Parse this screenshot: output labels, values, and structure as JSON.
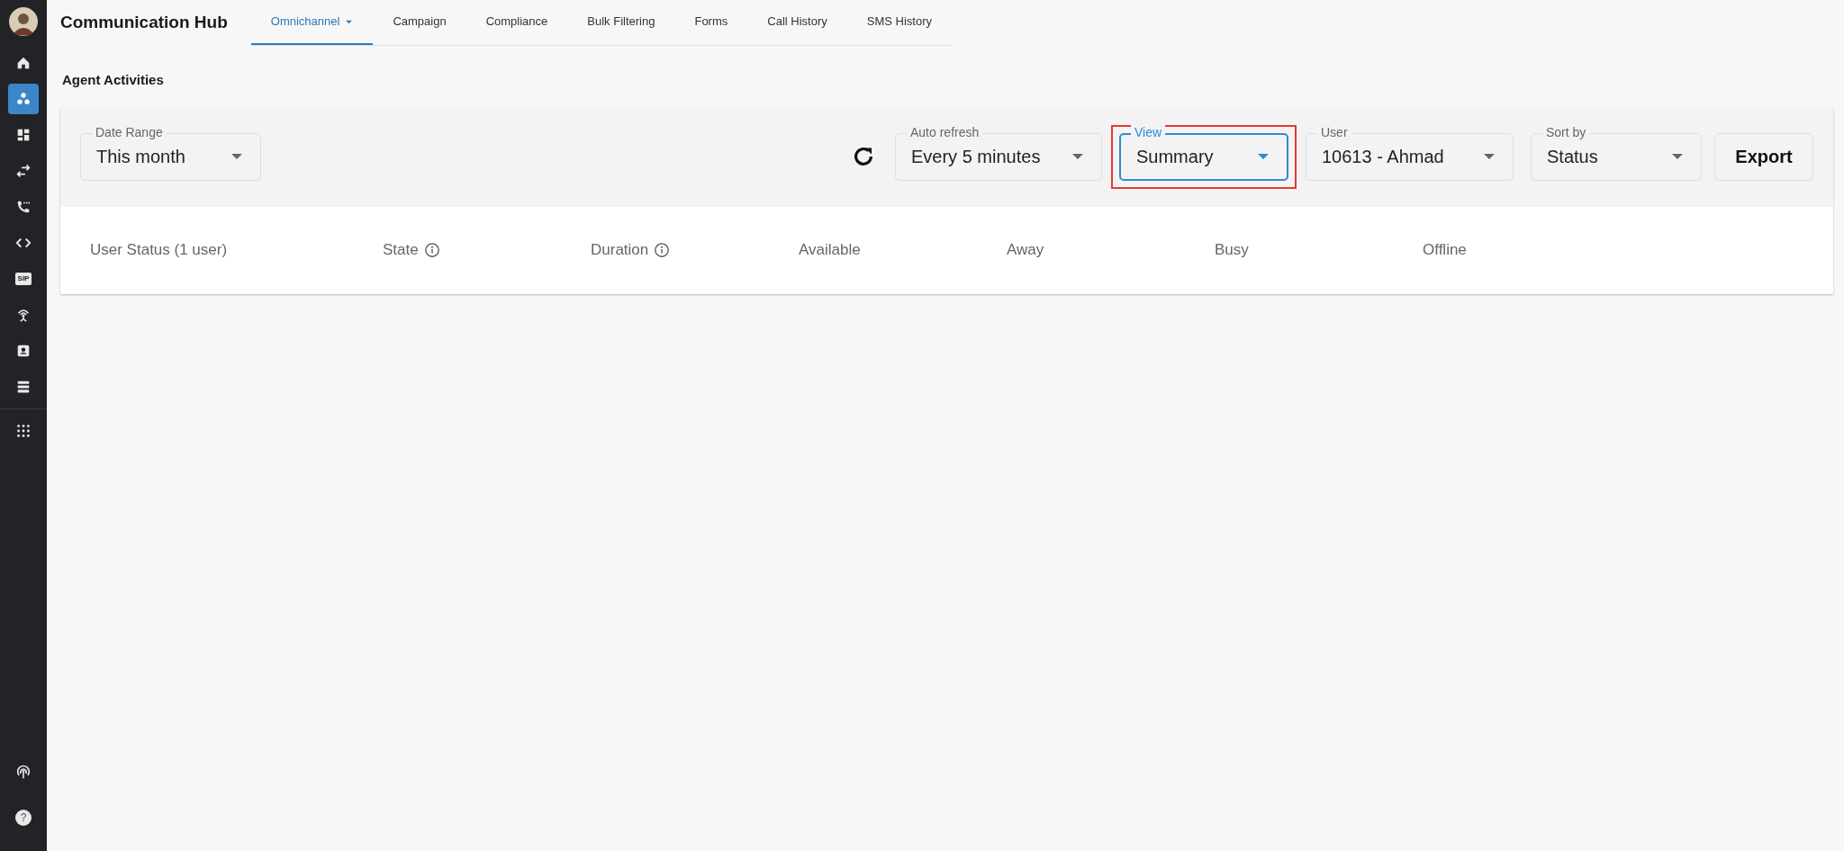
{
  "app": {
    "title": "Communication Hub"
  },
  "sidebar": {
    "items": [
      {
        "selected": false
      },
      {
        "selected": true
      },
      {
        "selected": false
      },
      {
        "selected": false
      },
      {
        "selected": false
      },
      {
        "selected": false
      },
      {
        "selected": false,
        "label": "SIP"
      },
      {
        "selected": false
      },
      {
        "selected": false
      },
      {
        "selected": false
      },
      {
        "selected": false
      }
    ],
    "bottom_items": [
      {
        "selected": false
      },
      {
        "selected": false,
        "label": "?"
      }
    ]
  },
  "tabs": [
    {
      "label": "Omnichannel",
      "selected": true,
      "dropdown": true
    },
    {
      "label": "Campaign",
      "selected": false,
      "dropdown": false
    },
    {
      "label": "Compliance",
      "selected": false,
      "dropdown": false
    },
    {
      "label": "Bulk Filtering",
      "selected": false,
      "dropdown": false
    },
    {
      "label": "Forms",
      "selected": false,
      "dropdown": false
    },
    {
      "label": "Call History",
      "selected": false,
      "dropdown": false
    },
    {
      "label": "SMS History",
      "selected": false,
      "dropdown": false
    }
  ],
  "page_title": "Agent Activities",
  "filters": [
    {
      "label": "Date Range",
      "value": "This month",
      "focused": false,
      "highlighted": false
    },
    {
      "kind": "refresh"
    },
    {
      "label": "Auto refresh",
      "value": "Every 5 minutes",
      "focused": false,
      "highlighted": false
    },
    {
      "label": "View",
      "value": "Summary",
      "focused": true,
      "highlighted": true
    },
    {
      "label": "User",
      "value": "10613 - Ahmad",
      "focused": false,
      "highlighted": false
    },
    {
      "label": "Sort by",
      "value": "Status",
      "focused": false,
      "highlighted": false
    }
  ],
  "export_button": "Export",
  "table": {
    "columns": [
      {
        "label": "User Status (1 user)",
        "info": false
      },
      {
        "label": "State",
        "info": true
      },
      {
        "label": "Duration",
        "info": true
      },
      {
        "label": "Available",
        "info": false
      },
      {
        "label": "Away",
        "info": false
      },
      {
        "label": "Busy",
        "info": false
      },
      {
        "label": "Offline",
        "info": false
      }
    ]
  }
}
